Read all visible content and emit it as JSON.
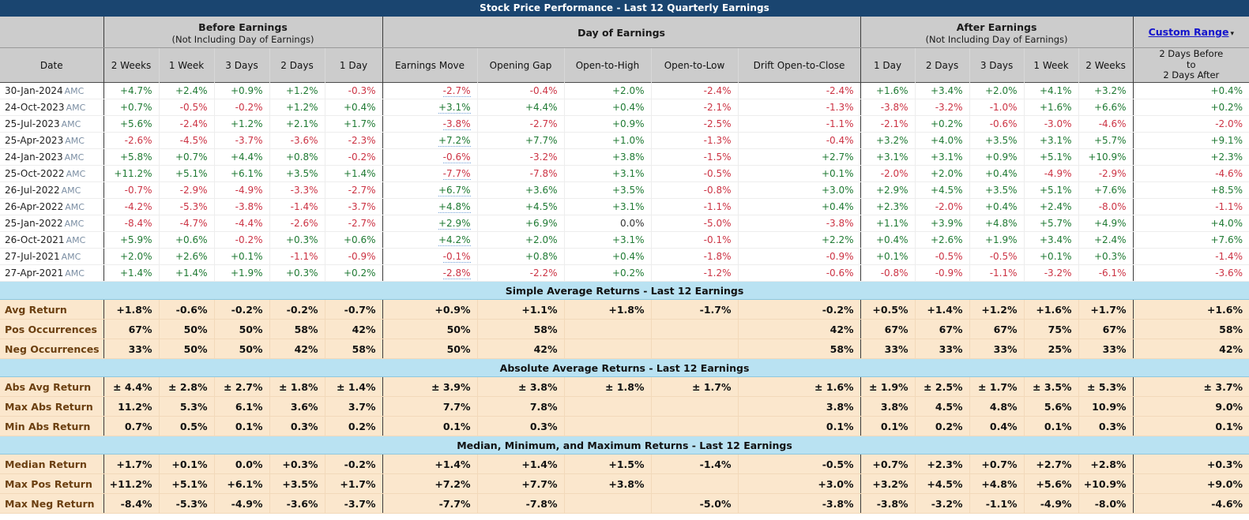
{
  "title": "Stock Price Performance - Last 12 Quarterly Earnings",
  "groups": {
    "before": {
      "line1": "Before Earnings",
      "line2": "(Not Including Day of Earnings)"
    },
    "day": {
      "line1": "Day of Earnings",
      "line2": ""
    },
    "after": {
      "line1": "After Earnings",
      "line2": "(Not Including Day of Earnings)"
    },
    "custom": {
      "label": "Custom Range",
      "caret": "▾"
    }
  },
  "columns": {
    "date": "Date",
    "before": [
      "2 Weeks",
      "1 Week",
      "3 Days",
      "2 Days",
      "1 Day"
    ],
    "day": [
      "Earnings Move",
      "Opening Gap",
      "Open-to-High",
      "Open-to-Low",
      "Drift Open-to-Close"
    ],
    "after": [
      "1 Day",
      "2 Days",
      "3 Days",
      "1 Week",
      "2 Weeks"
    ],
    "custom_l1": "2 Days Before",
    "custom_l2": "to",
    "custom_l3": "2 Days After"
  },
  "rows": [
    {
      "date": "30-Jan-2024",
      "session": "AMC",
      "cells": [
        "+4.7%",
        "+2.4%",
        "+0.9%",
        "+1.2%",
        "-0.3%",
        "-2.7%",
        "-0.4%",
        "+2.0%",
        "-2.4%",
        "-2.4%",
        "+1.6%",
        "+3.4%",
        "+2.0%",
        "+4.1%",
        "+3.2%",
        "+0.4%"
      ]
    },
    {
      "date": "24-Oct-2023",
      "session": "AMC",
      "cells": [
        "+0.7%",
        "-0.5%",
        "-0.2%",
        "+1.2%",
        "+0.4%",
        "+3.1%",
        "+4.4%",
        "+0.4%",
        "-2.1%",
        "-1.3%",
        "-3.8%",
        "-3.2%",
        "-1.0%",
        "+1.6%",
        "+6.6%",
        "+0.2%"
      ]
    },
    {
      "date": "25-Jul-2023",
      "session": "AMC",
      "cells": [
        "+5.6%",
        "-2.4%",
        "+1.2%",
        "+2.1%",
        "+1.7%",
        "-3.8%",
        "-2.7%",
        "+0.9%",
        "-2.5%",
        "-1.1%",
        "-2.1%",
        "+0.2%",
        "-0.6%",
        "-3.0%",
        "-4.6%",
        "-2.0%"
      ]
    },
    {
      "date": "25-Apr-2023",
      "session": "AMC",
      "cells": [
        "-2.6%",
        "-4.5%",
        "-3.7%",
        "-3.6%",
        "-2.3%",
        "+7.2%",
        "+7.7%",
        "+1.0%",
        "-1.3%",
        "-0.4%",
        "+3.2%",
        "+4.0%",
        "+3.5%",
        "+3.1%",
        "+5.7%",
        "+9.1%"
      ]
    },
    {
      "date": "24-Jan-2023",
      "session": "AMC",
      "cells": [
        "+5.8%",
        "+0.7%",
        "+4.4%",
        "+0.8%",
        "-0.2%",
        "-0.6%",
        "-3.2%",
        "+3.8%",
        "-1.5%",
        "+2.7%",
        "+3.1%",
        "+3.1%",
        "+0.9%",
        "+5.1%",
        "+10.9%",
        "+2.3%"
      ]
    },
    {
      "date": "25-Oct-2022",
      "session": "AMC",
      "cells": [
        "+11.2%",
        "+5.1%",
        "+6.1%",
        "+3.5%",
        "+1.4%",
        "-7.7%",
        "-7.8%",
        "+3.1%",
        "-0.5%",
        "+0.1%",
        "-2.0%",
        "+2.0%",
        "+0.4%",
        "-4.9%",
        "-2.9%",
        "-4.6%"
      ]
    },
    {
      "date": "26-Jul-2022",
      "session": "AMC",
      "cells": [
        "-0.7%",
        "-2.9%",
        "-4.9%",
        "-3.3%",
        "-2.7%",
        "+6.7%",
        "+3.6%",
        "+3.5%",
        "-0.8%",
        "+3.0%",
        "+2.9%",
        "+4.5%",
        "+3.5%",
        "+5.1%",
        "+7.6%",
        "+8.5%"
      ]
    },
    {
      "date": "26-Apr-2022",
      "session": "AMC",
      "cells": [
        "-4.2%",
        "-5.3%",
        "-3.8%",
        "-1.4%",
        "-3.7%",
        "+4.8%",
        "+4.5%",
        "+3.1%",
        "-1.1%",
        "+0.4%",
        "+2.3%",
        "-2.0%",
        "+0.4%",
        "+2.4%",
        "-8.0%",
        "-1.1%"
      ]
    },
    {
      "date": "25-Jan-2022",
      "session": "AMC",
      "cells": [
        "-8.4%",
        "-4.7%",
        "-4.4%",
        "-2.6%",
        "-2.7%",
        "+2.9%",
        "+6.9%",
        "0.0%",
        "-5.0%",
        "-3.8%",
        "+1.1%",
        "+3.9%",
        "+4.8%",
        "+5.7%",
        "+4.9%",
        "+4.0%"
      ]
    },
    {
      "date": "26-Oct-2021",
      "session": "AMC",
      "cells": [
        "+5.9%",
        "+0.6%",
        "-0.2%",
        "+0.3%",
        "+0.6%",
        "+4.2%",
        "+2.0%",
        "+3.1%",
        "-0.1%",
        "+2.2%",
        "+0.4%",
        "+2.6%",
        "+1.9%",
        "+3.4%",
        "+2.4%",
        "+7.6%"
      ]
    },
    {
      "date": "27-Jul-2021",
      "session": "AMC",
      "cells": [
        "+2.0%",
        "+2.6%",
        "+0.1%",
        "-1.1%",
        "-0.9%",
        "-0.1%",
        "+0.8%",
        "+0.4%",
        "-1.8%",
        "-0.9%",
        "+0.1%",
        "-0.5%",
        "-0.5%",
        "+0.1%",
        "+0.3%",
        "-1.4%"
      ]
    },
    {
      "date": "27-Apr-2021",
      "session": "AMC",
      "cells": [
        "+1.4%",
        "+1.4%",
        "+1.9%",
        "+0.3%",
        "+0.2%",
        "-2.8%",
        "-2.2%",
        "+0.2%",
        "-1.2%",
        "-0.6%",
        "-0.8%",
        "-0.9%",
        "-1.1%",
        "-3.2%",
        "-6.1%",
        "-3.6%"
      ]
    }
  ],
  "sections": [
    {
      "banner": "Simple Average Returns - Last 12 Earnings",
      "rows": [
        {
          "label": "Avg Return",
          "cells": [
            "+1.8%",
            "-0.6%",
            "-0.2%",
            "-0.2%",
            "-0.7%",
            "+0.9%",
            "+1.1%",
            "+1.8%",
            "-1.7%",
            "-0.2%",
            "+0.5%",
            "+1.4%",
            "+1.2%",
            "+1.6%",
            "+1.7%",
            "+1.6%"
          ],
          "tone": [
            "pos",
            "neg",
            "neg",
            "neg",
            "neg",
            "pos",
            "pos",
            "pos",
            "neg",
            "neg",
            "pos",
            "pos",
            "pos",
            "pos",
            "pos",
            "pos"
          ]
        },
        {
          "label": "Pos Occurrences",
          "cells": [
            "67%",
            "50%",
            "50%",
            "58%",
            "42%",
            "50%",
            "58%",
            "",
            "",
            "42%",
            "67%",
            "67%",
            "67%",
            "75%",
            "67%",
            "58%"
          ],
          "tone": [
            "neu",
            "neu",
            "neu",
            "neu",
            "neu",
            "neu",
            "neu",
            "neu",
            "neu",
            "neu",
            "neu",
            "neu",
            "neu",
            "neu",
            "neu",
            "neu"
          ]
        },
        {
          "label": "Neg Occurrences",
          "cells": [
            "33%",
            "50%",
            "50%",
            "42%",
            "58%",
            "50%",
            "42%",
            "",
            "",
            "58%",
            "33%",
            "33%",
            "33%",
            "25%",
            "33%",
            "42%"
          ],
          "tone": [
            "neu",
            "neu",
            "neu",
            "neu",
            "neu",
            "neu",
            "neu",
            "neu",
            "neu",
            "neu",
            "neu",
            "neu",
            "neu",
            "neu",
            "neu",
            "neu"
          ]
        }
      ]
    },
    {
      "banner": "Absolute Average Returns - Last 12 Earnings",
      "rows": [
        {
          "label": "Abs Avg Return",
          "cells": [
            "± 4.4%",
            "± 2.8%",
            "± 2.7%",
            "± 1.8%",
            "± 1.4%",
            "± 3.9%",
            "± 3.8%",
            "± 1.8%",
            "± 1.7%",
            "± 1.6%",
            "± 1.9%",
            "± 2.5%",
            "± 1.7%",
            "± 3.5%",
            "± 5.3%",
            "± 3.7%"
          ],
          "tone": [
            "neu",
            "neu",
            "neu",
            "neu",
            "neu",
            "neu",
            "neu",
            "neu",
            "neu",
            "neu",
            "neu",
            "neu",
            "neu",
            "neu",
            "neu",
            "neu"
          ]
        },
        {
          "label": "Max Abs Return",
          "cells": [
            "11.2%",
            "5.3%",
            "6.1%",
            "3.6%",
            "3.7%",
            "7.7%",
            "7.8%",
            "",
            "",
            "3.8%",
            "3.8%",
            "4.5%",
            "4.8%",
            "5.6%",
            "10.9%",
            "9.0%"
          ],
          "tone": [
            "neu",
            "neu",
            "neu",
            "neu",
            "neu",
            "neu",
            "neu",
            "neu",
            "neu",
            "neu",
            "neu",
            "neu",
            "neu",
            "neu",
            "neu",
            "neu"
          ]
        },
        {
          "label": "Min Abs Return",
          "cells": [
            "0.7%",
            "0.5%",
            "0.1%",
            "0.3%",
            "0.2%",
            "0.1%",
            "0.3%",
            "",
            "",
            "0.1%",
            "0.1%",
            "0.2%",
            "0.4%",
            "0.1%",
            "0.3%",
            "0.1%"
          ],
          "tone": [
            "neu",
            "neu",
            "neu",
            "neu",
            "neu",
            "neu",
            "neu",
            "neu",
            "neu",
            "neu",
            "neu",
            "neu",
            "neu",
            "neu",
            "neu",
            "neu"
          ]
        }
      ]
    },
    {
      "banner": "Median, Minimum, and Maximum Returns - Last 12 Earnings",
      "rows": [
        {
          "label": "Median Return",
          "cells": [
            "+1.7%",
            "+0.1%",
            "0.0%",
            "+0.3%",
            "-0.2%",
            "+1.4%",
            "+1.4%",
            "+1.5%",
            "-1.4%",
            "-0.5%",
            "+0.7%",
            "+2.3%",
            "+0.7%",
            "+2.7%",
            "+2.8%",
            "+0.3%"
          ],
          "tone": [
            "pos",
            "pos",
            "neg",
            "pos",
            "neg",
            "pos",
            "pos",
            "pos",
            "neg",
            "neg",
            "pos",
            "pos",
            "pos",
            "pos",
            "pos",
            "pos"
          ]
        },
        {
          "label": "Max Pos Return",
          "cells": [
            "+11.2%",
            "+5.1%",
            "+6.1%",
            "+3.5%",
            "+1.7%",
            "+7.2%",
            "+7.7%",
            "+3.8%",
            "",
            "+3.0%",
            "+3.2%",
            "+4.5%",
            "+4.8%",
            "+5.6%",
            "+10.9%",
            "+9.0%"
          ],
          "tone": [
            "pos",
            "pos",
            "pos",
            "pos",
            "pos",
            "pos",
            "pos",
            "pos",
            "pos",
            "pos",
            "pos",
            "pos",
            "pos",
            "pos",
            "pos",
            "pos"
          ]
        },
        {
          "label": "Max Neg Return",
          "cells": [
            "-8.4%",
            "-5.3%",
            "-4.9%",
            "-3.6%",
            "-3.7%",
            "-7.7%",
            "-7.8%",
            "",
            "-5.0%",
            "-3.8%",
            "-3.8%",
            "-3.2%",
            "-1.1%",
            "-4.9%",
            "-8.0%",
            "-4.6%"
          ],
          "tone": [
            "neg",
            "neg",
            "neg",
            "neg",
            "neg",
            "neg",
            "neg",
            "neg",
            "neg",
            "neg",
            "neg",
            "neg",
            "neg",
            "neg",
            "neg",
            "neg"
          ]
        }
      ]
    }
  ],
  "colors": {
    "title_bar": "#1a4570",
    "header_bg": "#cccccc",
    "banner_bg": "#b9e2f2",
    "summary_bg": "#fbe7cd",
    "positive": "#1f7a33",
    "negative": "#cc3344",
    "link": "#1414cc"
  }
}
